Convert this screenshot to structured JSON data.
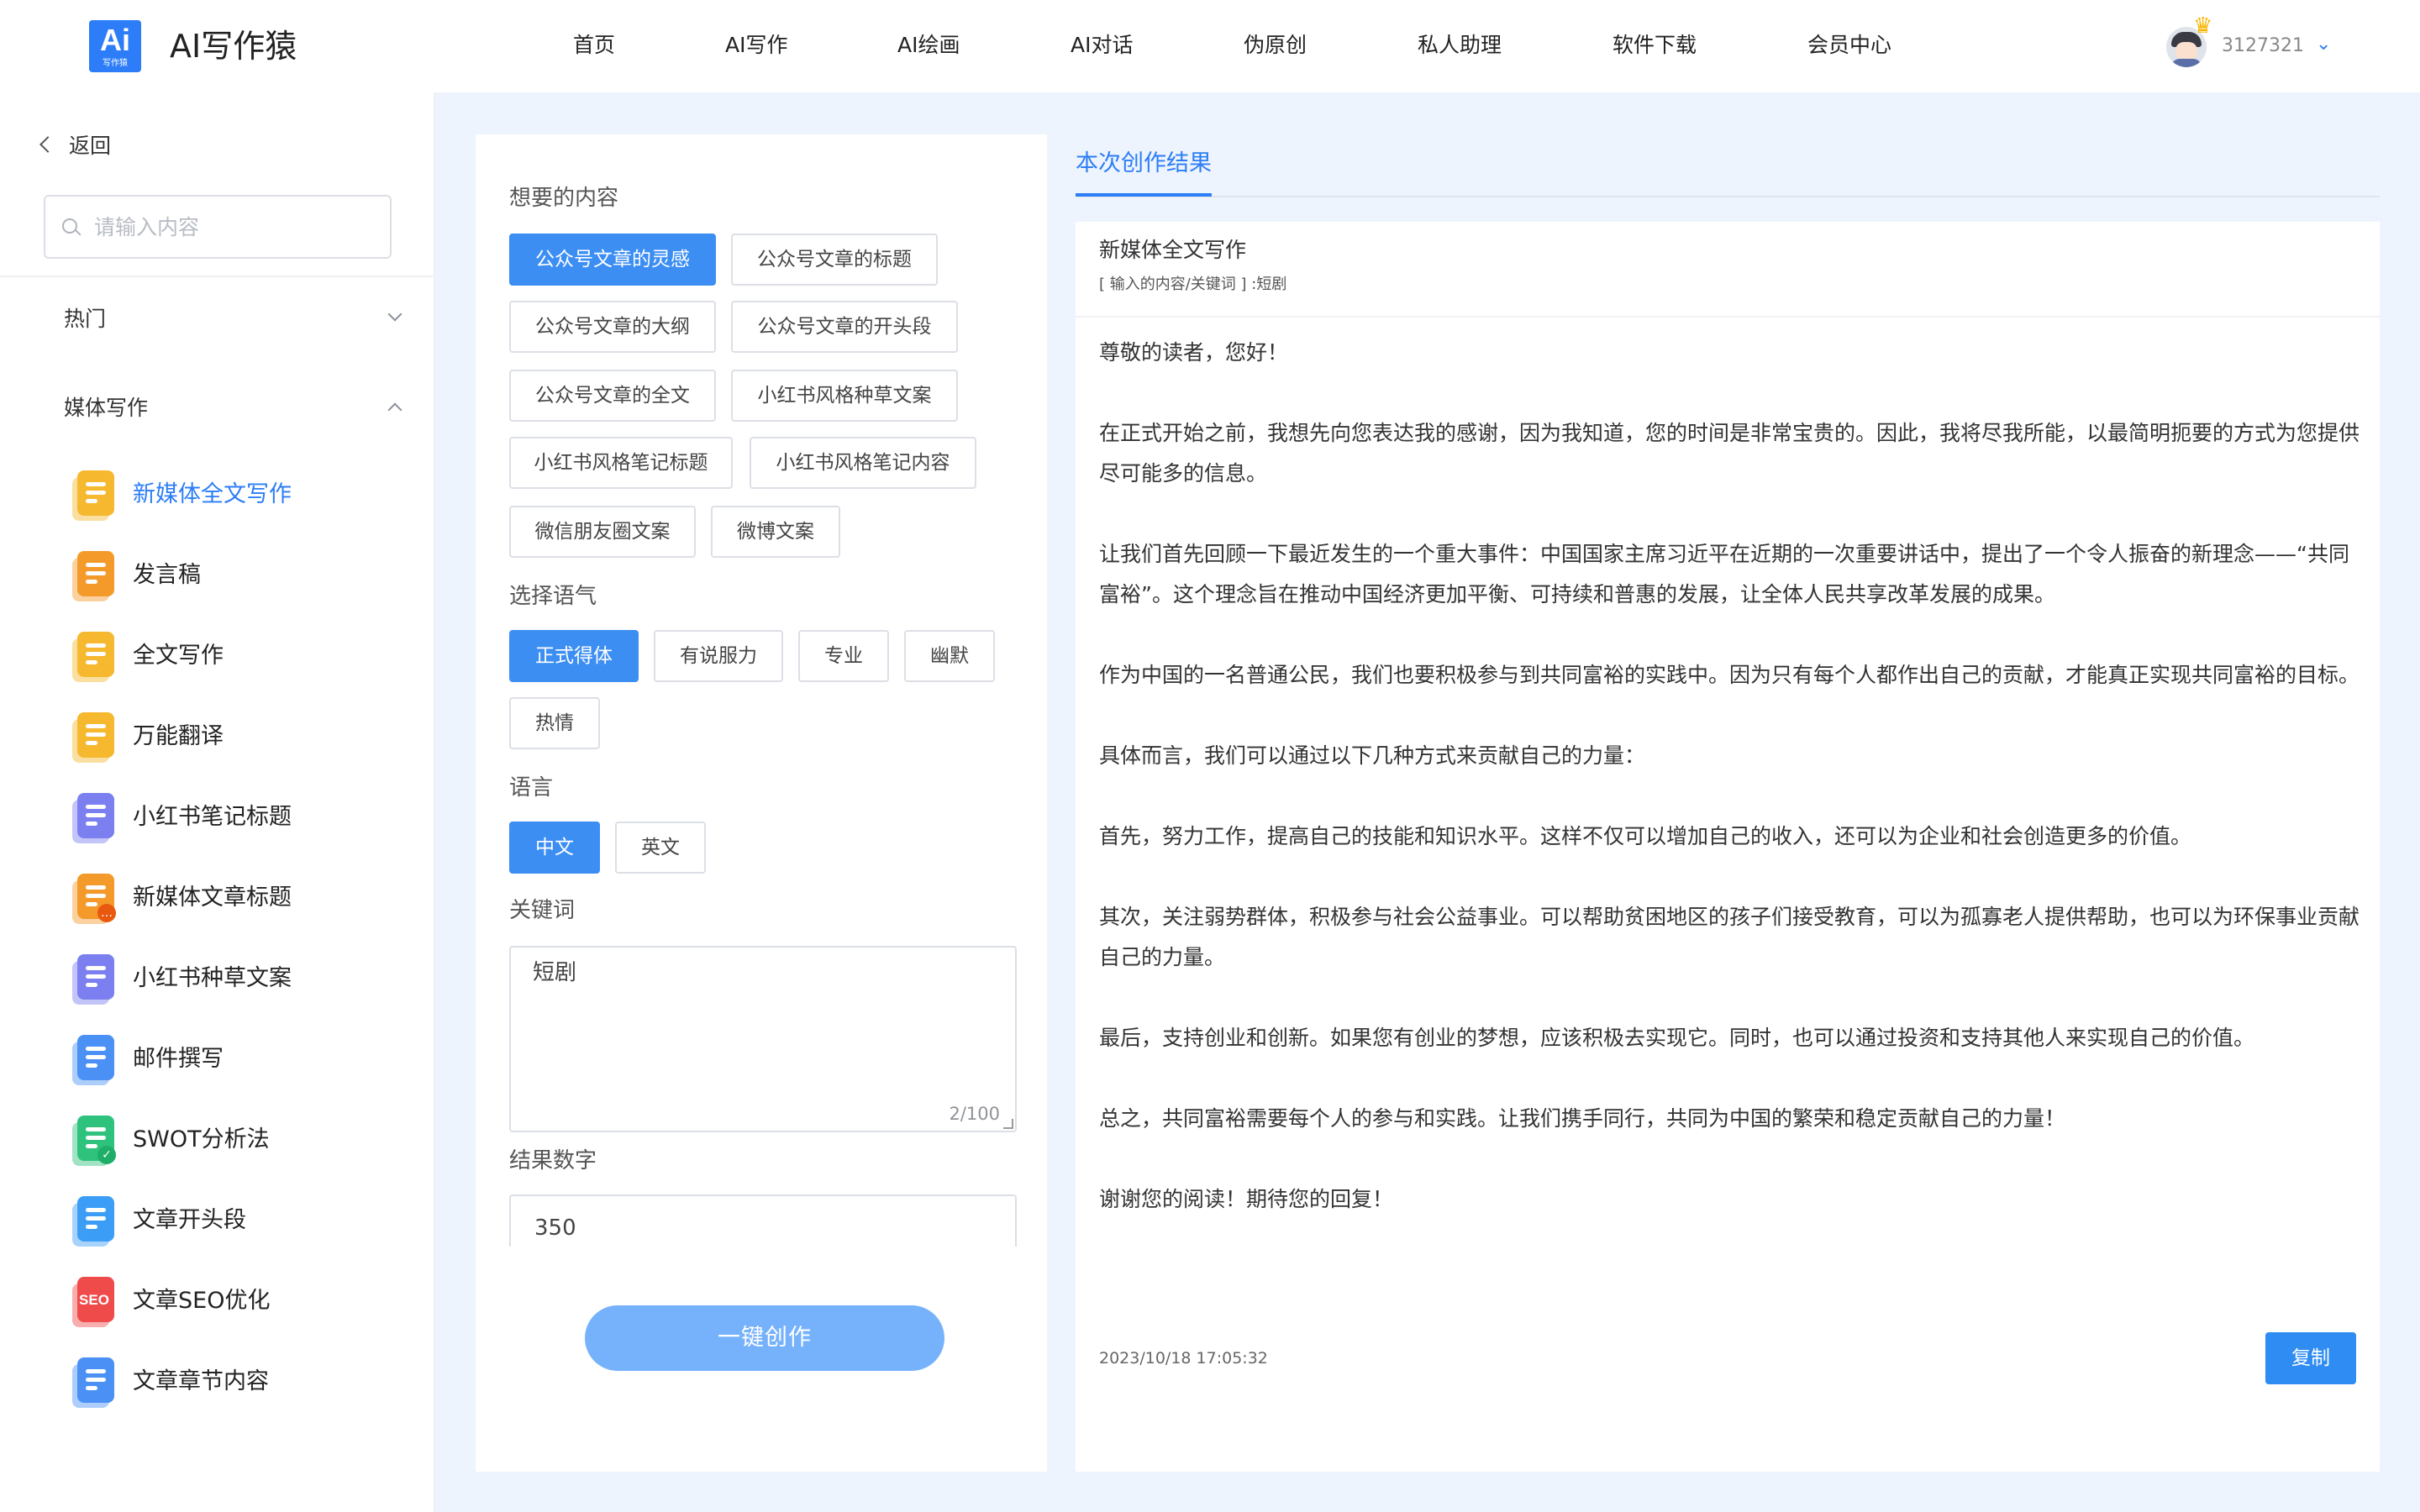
{
  "header": {
    "logo_big": "Ai",
    "logo_small": "写作猿",
    "app_title": "AI写作猿",
    "nav": [
      "首页",
      "AI写作",
      "AI绘画",
      "AI对话",
      "伪原创",
      "私人助理",
      "软件下载",
      "会员中心"
    ],
    "user_id": "3127321",
    "user_caret": "⌄"
  },
  "sidebar": {
    "back_label": "返回",
    "search_placeholder": "请输入内容",
    "categories": [
      "热门",
      "媒体写作"
    ],
    "items": [
      {
        "label": "新媒体全文写作",
        "icon": "doc-yellow-icon",
        "color": "#f5b82e"
      },
      {
        "label": "发言稿",
        "icon": "speech-orange-icon",
        "color": "#f39a2b"
      },
      {
        "label": "全文写作",
        "icon": "doc-yellow-icon",
        "color": "#f5b82e"
      },
      {
        "label": "万能翻译",
        "icon": "chat-bubble-icon",
        "color": "#f5b82e"
      },
      {
        "label": "小红书笔记标题",
        "icon": "bookmark-purple-icon",
        "color": "#7b7ff0"
      },
      {
        "label": "新媒体文章标题",
        "icon": "doc-badge-orange-icon",
        "color": "#f39a2b"
      },
      {
        "label": "小红书种草文案",
        "icon": "bookmark-purple-icon",
        "color": "#7b7ff0"
      },
      {
        "label": "邮件撰写",
        "icon": "edit-blue-icon",
        "color": "#4a90f5"
      },
      {
        "label": "SWOT分析法",
        "icon": "check-green-icon",
        "color": "#2fc27d"
      },
      {
        "label": "文章开头段",
        "icon": "doc-blue-icon",
        "color": "#3c9df7"
      },
      {
        "label": "文章SEO优化",
        "icon": "seo-calendar-icon",
        "color": "#ef4b4b",
        "icon_text": "SEO"
      },
      {
        "label": "文章章节内容",
        "icon": "doc-blue-icon",
        "color": "#4a90f5"
      }
    ]
  },
  "form": {
    "content_label": "想要的内容",
    "content_options": [
      "公众号文章的灵感",
      "公众号文章的标题",
      "公众号文章的大纲",
      "公众号文章的开头段",
      "公众号文章的全文",
      "小红书风格种草文案",
      "小红书风格笔记标题",
      "小红书风格笔记内容",
      "微信朋友圈文案",
      "微博文案"
    ],
    "tone_label": "选择语气",
    "tone_options": [
      "正式得体",
      "有说服力",
      "专业",
      "幽默",
      "热情"
    ],
    "language_label": "语言",
    "language_options": [
      "中文",
      "英文"
    ],
    "keyword_label": "关键词",
    "keyword_value": "短剧",
    "keyword_counter": "2/100",
    "count_label": "结果数字",
    "count_value": "350",
    "create_button": "一键创作"
  },
  "result": {
    "tab_label": "本次创作结果",
    "title": "新媒体全文写作",
    "subtitle": "[ 输入的内容/关键词 ] :短剧",
    "paragraphs": [
      "尊敬的读者，您好！",
      "在正式开始之前，我想先向您表达我的感谢，因为我知道，您的时间是非常宝贵的。因此，我将尽我所能，以最简明扼要的方式为您提供尽可能多的信息。",
      "让我们首先回顾一下最近发生的一个重大事件：中国国家主席习近平在近期的一次重要讲话中，提出了一个令人振奋的新理念——“共同富裕”。这个理念旨在推动中国经济更加平衡、可持续和普惠的发展，让全体人民共享改革发展的成果。",
      "作为中国的一名普通公民，我们也要积极参与到共同富裕的实践中。因为只有每个人都作出自己的贡献，才能真正实现共同富裕的目标。",
      "具体而言，我们可以通过以下几种方式来贡献自己的力量：",
      "首先，努力工作，提高自己的技能和知识水平。这样不仅可以增加自己的收入，还可以为企业和社会创造更多的价值。",
      "其次，关注弱势群体，积极参与社会公益事业。可以帮助贫困地区的孩子们接受教育，可以为孤寡老人提供帮助，也可以为环保事业贡献自己的力量。",
      "最后，支持创业和创新。如果您有创业的梦想，应该积极去实现它。同时，也可以通过投资和支持其他人来实现自己的价值。",
      "总之，共同富裕需要每个人的参与和实践。让我们携手同行，共同为中国的繁荣和稳定贡献自己的力量！",
      "谢谢您的阅读！期待您的回复！"
    ],
    "timestamp": "2023/10/18 17:05:32",
    "copy_button": "复制"
  }
}
